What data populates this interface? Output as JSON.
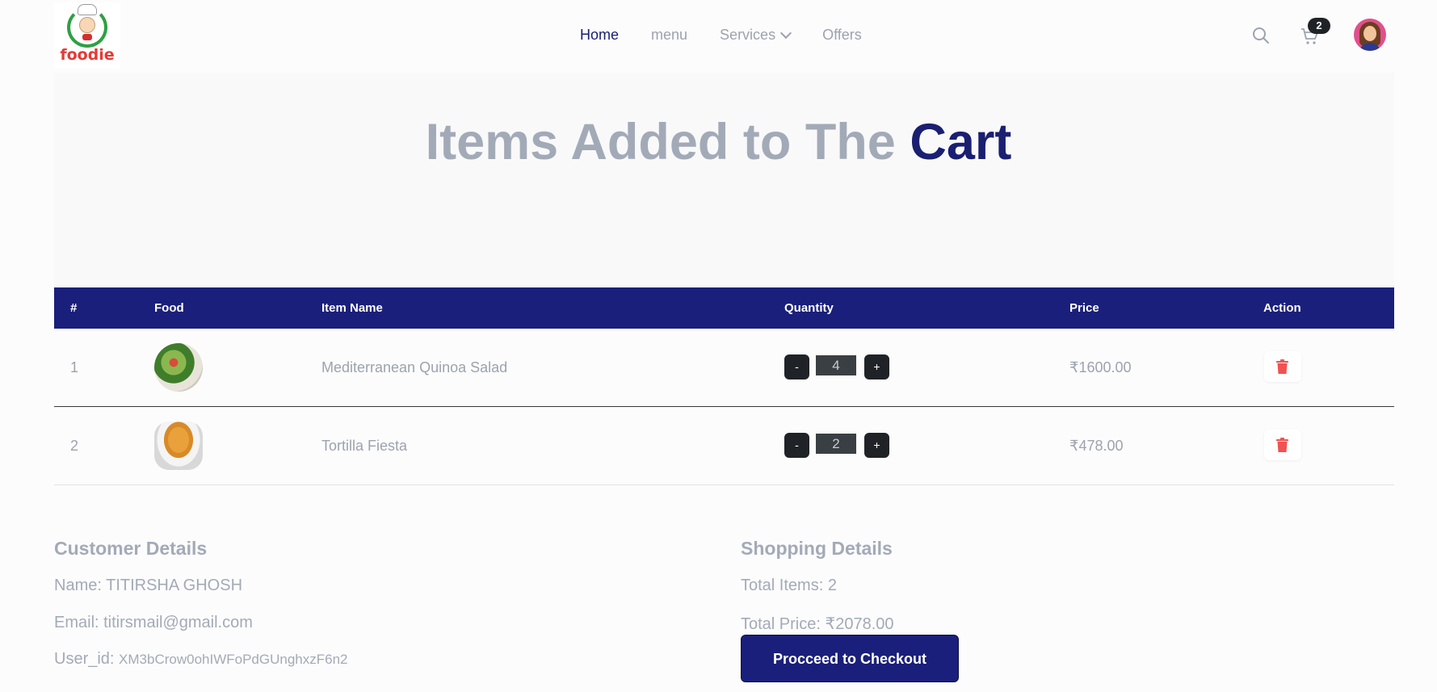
{
  "brand": {
    "logo_text": "foodie"
  },
  "nav": {
    "links": [
      "Home",
      "menu",
      "Services",
      "Offers"
    ],
    "cart_count": "2"
  },
  "page": {
    "title_part1": "Items Added to The",
    "title_part2": "Cart"
  },
  "table": {
    "headers": [
      "#",
      "Food",
      "Item Name",
      "Quantity",
      "Price",
      "Action"
    ],
    "rows": [
      {
        "index": "1",
        "image": "salad-image",
        "name": "Mediterranean Quinoa Salad",
        "decrement": "-",
        "quantity": "4",
        "increment": "+",
        "price": "₹1600.00"
      },
      {
        "index": "2",
        "image": "soup-image",
        "name": "Tortilla Fiesta",
        "decrement": "-",
        "quantity": "2",
        "increment": "+",
        "price": "₹478.00"
      }
    ]
  },
  "customer": {
    "heading": "Customer Details",
    "name": "Name: TITIRSHA GHOSH",
    "email": "Email: titirsmail@gmail.com",
    "user_id_label": "User_id:",
    "user_id": "XM3bCrow0ohIWFoPdGUnghxzF6n2"
  },
  "shopping": {
    "heading": "Shopping Details",
    "total_items": "Total Items: 2",
    "total_price": "Total Price: ₹2078.00",
    "checkout_label": "Procceed to Checkout"
  },
  "colors": {
    "navy": "#1a1f7b",
    "muted": "#a3aab7",
    "delete": "#f05252"
  }
}
